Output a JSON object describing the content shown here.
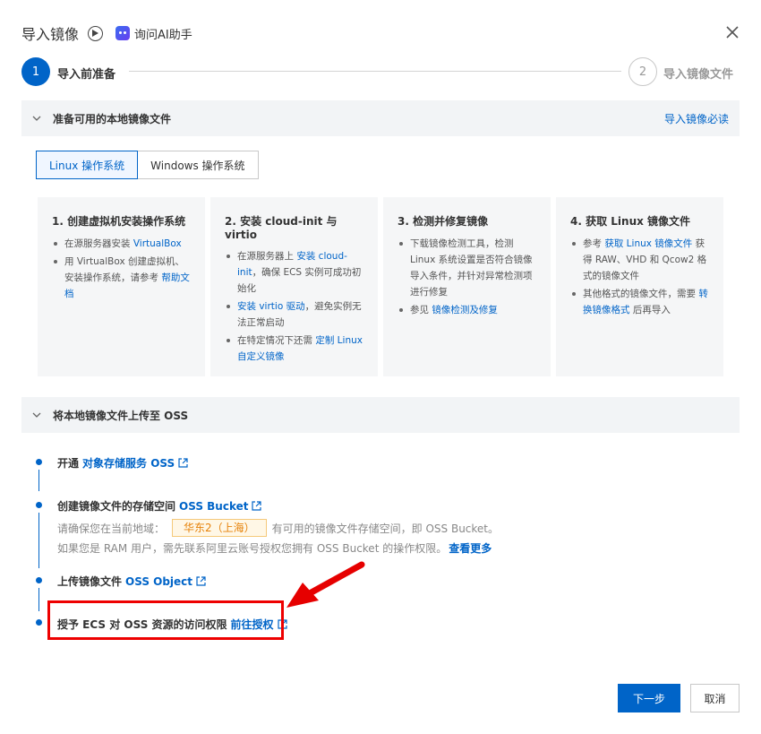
{
  "dialog": {
    "title": "导入镜像",
    "ai_label": "询问AI助手"
  },
  "steps": [
    {
      "number": "1",
      "label": "导入前准备"
    },
    {
      "number": "2",
      "label": "导入镜像文件"
    }
  ],
  "section1": {
    "title": "准备可用的本地镜像文件",
    "link": "导入镜像必读",
    "tabs": [
      "Linux 操作系统",
      "Windows 操作系统"
    ],
    "cards": [
      {
        "title": "1. 创建虚拟机安装操作系统",
        "items": [
          {
            "pre": "在源服务器安装 ",
            "link": "VirtualBox",
            "post": ""
          },
          {
            "pre": "用 VirtualBox 创建虚拟机、安装操作系统，请参考 ",
            "link": "帮助文档",
            "post": ""
          }
        ]
      },
      {
        "title": "2. 安装 cloud-init 与 virtio",
        "items": [
          {
            "pre": "在源服务器上 ",
            "link": "安装 cloud-init",
            "post": "，确保 ECS 实例可成功初始化"
          },
          {
            "pre": "",
            "link": "安装 virtio 驱动",
            "post": "，避免实例无法正常启动"
          },
          {
            "pre": "在特定情况下还需 ",
            "link": "定制 Linux 自定义镜像",
            "post": ""
          }
        ]
      },
      {
        "title": "3. 检测并修复镜像",
        "items": [
          {
            "pre": "下载镜像检测工具，检测 Linux 系统设置是否符合镜像导入条件，并针对异常检测项进行修复",
            "link": "",
            "post": ""
          },
          {
            "pre": "参见 ",
            "link": "镜像检测及修复",
            "post": ""
          }
        ]
      },
      {
        "title": "4. 获取 Linux 镜像文件",
        "items": [
          {
            "pre": "参考 ",
            "link": "获取 Linux 镜像文件",
            "post": " 获得 RAW、VHD 和 Qcow2 格式的镜像文件"
          },
          {
            "pre": "其他格式的镜像文件，需要 ",
            "link": "转换镜像格式",
            "post": " 后再导入"
          }
        ]
      }
    ]
  },
  "section2": {
    "title": "将本地镜像文件上传至 OSS",
    "items": [
      {
        "text": "开通",
        "link": "对象存储服务 OSS"
      },
      {
        "text": "创建镜像文件的存储空间",
        "link": "OSS Bucket"
      },
      {
        "text": "上传镜像文件",
        "link": "OSS Object"
      },
      {
        "text": "授予 ECS 对 OSS 资源的访问权限",
        "link": "前往授权"
      }
    ],
    "note1_pre": "请确保您在当前地域：",
    "region": "华东2（上海）",
    "note1_post": "有可用的镜像文件存储空间，即 OSS Bucket。",
    "note2_pre": "如果您是 RAM 用户，需先联系阿里云账号授权您拥有 OSS Bucket 的操作权限。",
    "note2_link": "查看更多"
  },
  "footer": {
    "next": "下一步",
    "cancel": "取消"
  },
  "colors": {
    "primary": "#0064c8",
    "highlight": "#ee0000",
    "region_bg": "#fff7e6",
    "region_text": "#e6820a"
  },
  "icons": [
    "play-circle-icon",
    "ai-assistant-icon",
    "close-icon",
    "chevron-down-icon",
    "external-link-icon",
    "red-arrow-annotation"
  ]
}
